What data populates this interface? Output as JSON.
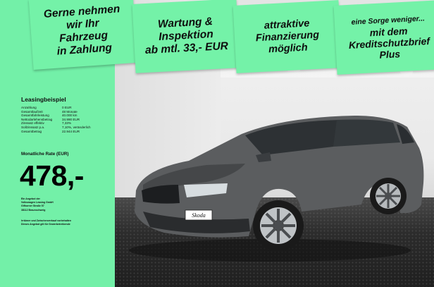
{
  "banners": [
    {
      "text": "Gerne nehmen\nwir Ihr\nFahrzeug\nin Zahlung"
    },
    {
      "text": "Wartung &\nInspektion\nab mtl. 33,- EUR"
    },
    {
      "text": "attraktive\nFinanzierung\nmöglich"
    },
    {
      "small": "eine Sorge weniger...",
      "text": "mit dem\nKreditschutzbrief\nPlus"
    }
  ],
  "lease": {
    "title": "Leasingbeispiel",
    "rows": [
      {
        "k": "Anzahlung",
        "v": "0 EUR"
      },
      {
        "k": "Gesamtlaufzeit",
        "v": "48 Monate"
      },
      {
        "k": "Gesamtfahrleistung",
        "v": "40.000 km"
      },
      {
        "k": "Nettodarlehensbetrag",
        "v": "34.990 EUR"
      },
      {
        "k": "Zinssatz effektiv",
        "v": "7,33%"
      },
      {
        "k": "Sollzinssatz p.a.",
        "v": "7,10%, veränderlich"
      },
      {
        "k": "Gesamtbetrag",
        "v": "22.944 EUR"
      }
    ],
    "rate_label": "Monatliche Rate (EUR)",
    "rate": "478,-",
    "provider_lines": [
      "Ein Angebot der",
      "Volkswagen Leasing GmbH",
      "Gifhorner Straße 57",
      "38112 Braunschweig"
    ],
    "note_lines": [
      "Irrtümer und Zwischenverkauf vorbehalten",
      "Dieses Angebot gilt für Gewerbetreibende"
    ]
  },
  "colors": {
    "accent": "#73f0a8",
    "car": "#5b5d5f"
  },
  "photo": {
    "plate_text": "Skoda"
  }
}
